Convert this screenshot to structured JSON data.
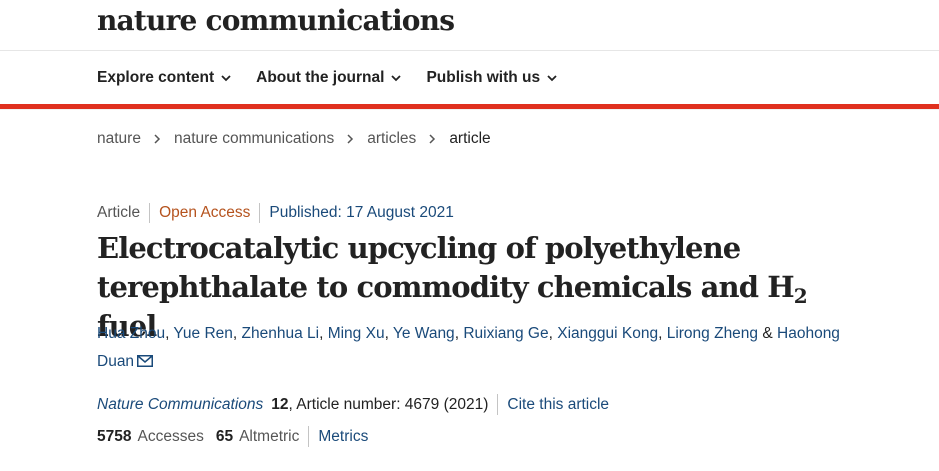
{
  "header": {
    "logo": "nature communications"
  },
  "nav": {
    "items": [
      {
        "label": "Explore content"
      },
      {
        "label": "About the journal"
      },
      {
        "label": "Publish with us"
      }
    ]
  },
  "breadcrumb": {
    "items": [
      "nature",
      "nature communications",
      "articles",
      "article"
    ]
  },
  "article": {
    "type": "Article",
    "access": "Open Access",
    "published": "Published: 17 August 2021",
    "title_part1": "Electrocatalytic upcycling of polyethylene terephthalate to commodity chemicals and H",
    "title_sub": "2",
    "title_part2": " fuel",
    "authors": [
      "Hua Zhou",
      "Yue Ren",
      "Zhenhua Li",
      "Ming Xu",
      "Ye Wang",
      "Ruixiang Ge",
      "Xianggui Kong",
      "Lirong Zheng"
    ],
    "author_amp": "&",
    "last_author": "Haohong Duan",
    "journal": "Nature Communications",
    "volume": "12",
    "article_number": ", Article number: 4679 (2021)",
    "cite_label": "Cite this article",
    "accesses_count": "5758",
    "accesses_label": "Accesses",
    "altmetric_count": "65",
    "altmetric_label": "Altmetric",
    "metrics_label": "Metrics"
  },
  "colors": {
    "accent_red": "#e0301e",
    "link_blue": "#1a4a7a",
    "open_access": "#b5531e"
  },
  "icons": {
    "nav_chevron": "chevron-down-icon",
    "breadcrumb_sep": "chevron-right-icon",
    "author_mail": "mail-icon"
  }
}
